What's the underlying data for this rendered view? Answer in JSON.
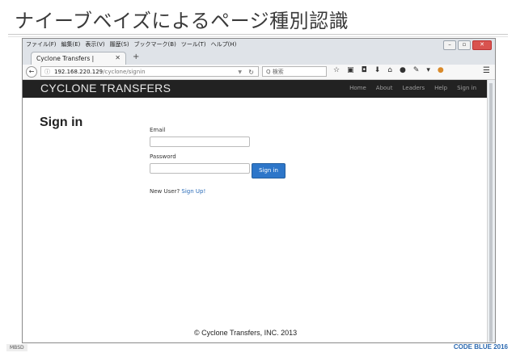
{
  "slide": {
    "title": "ナイーブベイズによるページ種別認識",
    "badge_left": "MBSD",
    "badge_right": "CODE BLUE 2016"
  },
  "browser": {
    "menu": [
      "ファイル(F)",
      "編集(E)",
      "表示(V)",
      "履歴(S)",
      "ブックマーク(B)",
      "ツール(T)",
      "ヘルプ(H)"
    ],
    "tab_title": "Cyclone Transfers |",
    "url_host": "192.168.220.129",
    "url_path": "/cyclone/signin",
    "search_placeholder": "Q 検索"
  },
  "site": {
    "brand": "CYCLONE TRANSFERS",
    "nav": [
      "Home",
      "About",
      "Leaders",
      "Help",
      "Sign in"
    ],
    "heading": "Sign in",
    "email_label": "Email",
    "password_label": "Password",
    "signin_button": "Sign in",
    "new_user_text": "New User?",
    "signup_link": "Sign Up!",
    "footer": "© Cyclone Transfers, INC. 2013"
  }
}
